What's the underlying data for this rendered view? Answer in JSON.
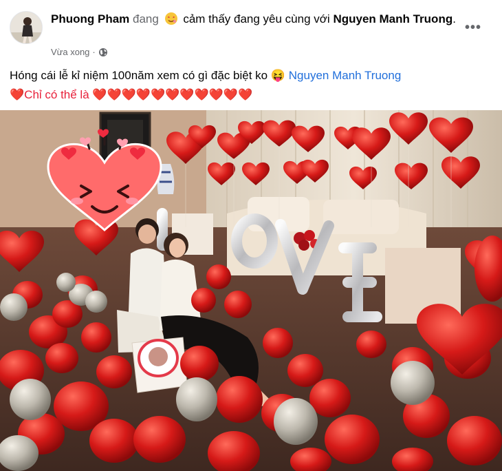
{
  "post": {
    "author": "Phuong Pham",
    "verb": "đang",
    "feeling_text": "cảm thấy đang yêu cùng với",
    "tagged": "Nguyen Manh Truong",
    "tagged_suffix": ".",
    "time": "Vừa xong",
    "time_separator": "·",
    "audience_icon": "globe-icon",
    "more_label": "•••",
    "caption_line1": "Hóng cái lễ kỉ niệm 100năm xem có gì đặc biệt ko",
    "caption_emoji": "😝",
    "caption_tag": "Nguyen Manh Truong",
    "caption_line2_prefix": "❤️Chỉ có thể là",
    "caption_hearts": "❤️❤️❤️❤️❤️❤️❤️❤️❤️❤️❤️",
    "photo_icon": "couple-balloons-photo",
    "sticker_icon": "love-face-sticker"
  },
  "colors": {
    "link": "#216fdb",
    "muted": "#65676b",
    "text": "#050505",
    "heart": "#e8213b",
    "balloon_red": "#d81a1a",
    "balloon_silver": "#bdb8ad"
  }
}
